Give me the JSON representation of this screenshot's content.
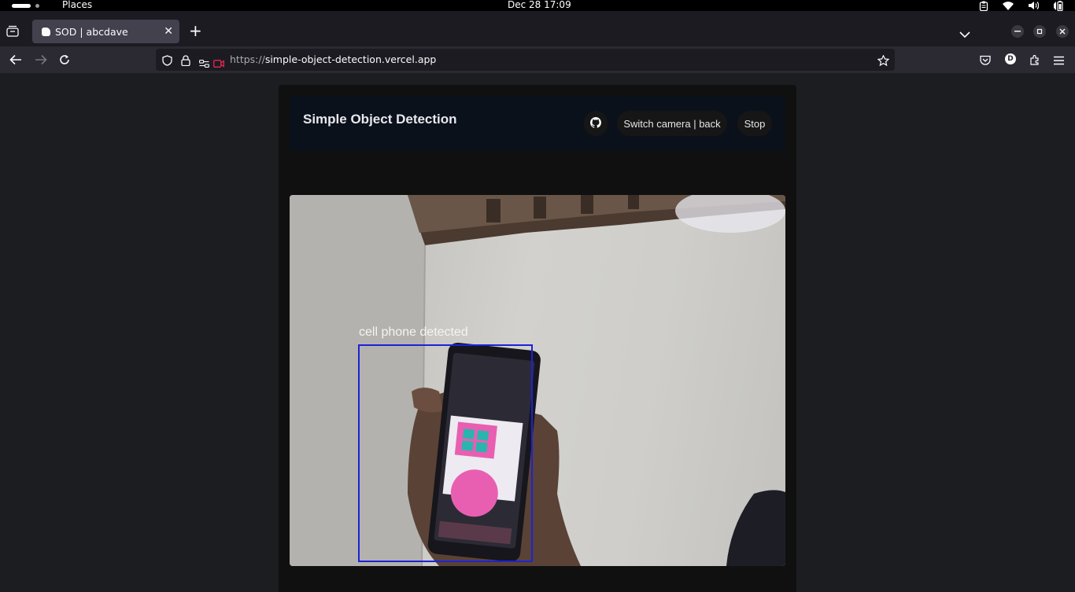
{
  "system_bar": {
    "places_label": "Places",
    "clock": "Dec 28  17:09"
  },
  "browser": {
    "tab": {
      "title": "SOD | abcdave"
    },
    "url": {
      "scheme": "https://",
      "host": "simple-object-detection.vercel.app"
    },
    "profile_initial": "D"
  },
  "app": {
    "title": "Simple Object Detection",
    "buttons": {
      "switch_camera": "Switch camera | back",
      "stop": "Stop"
    },
    "detection": {
      "label": "cell phone detected",
      "box_color": "#1d22d6"
    }
  },
  "colors": {
    "page_bg": "#1c1d21",
    "container_bg": "#101010",
    "header_bg": "#0b111b",
    "camera_icon_red": "#e22850"
  }
}
